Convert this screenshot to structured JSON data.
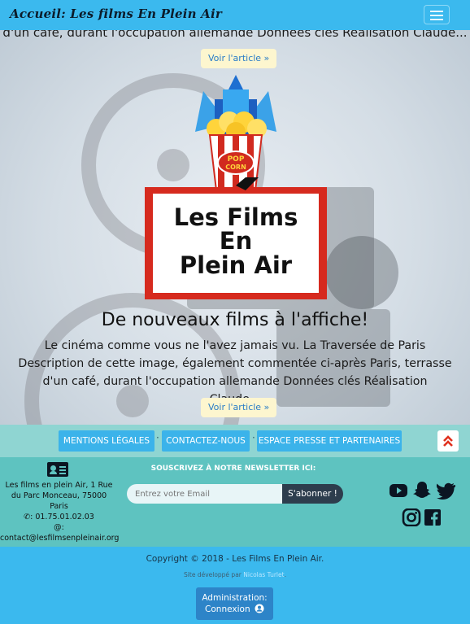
{
  "navbar": {
    "brand": "Accueil: Les films En Plein Air"
  },
  "articles": [
    {
      "excerpt_tail": "d'un café, durant l'occupation allemande Données clés Réalisation Claude...",
      "button": "Voir l'article »"
    },
    {
      "title": "De nouveaux films à l'affiche!",
      "line1": "Le cinéma comme vous ne l'avez jamais vu. La Traversée de Paris",
      "line2": "Description de cette image, également commentée ci-après Paris, terrasse",
      "line3": "d'un café, durant l'occupation allemande Données clés Réalisation Claude...",
      "button": "Voir l'article »"
    }
  ],
  "logo": {
    "line1": "Les Films",
    "line2": "En",
    "line3": "Plein Air",
    "popcorn1": "POP",
    "popcorn2": "CORN"
  },
  "footer_links": [
    "MENTIONS LÉGALES",
    "CONTACTEZ-NOUS",
    "ESPACE PRESSE ET PARTENAIRES"
  ],
  "separator": "·",
  "scroll_top_icon": "double-chevron-up-icon",
  "contact": {
    "address_1": "Les films en plein Air, 1 Rue",
    "address_2": "du Parc Monceau, 75000",
    "address_3": "Paris",
    "phone": ": 01.75.01.02.03",
    "email_label": "@:",
    "email": "contact@lesfilmsenpleinair.org"
  },
  "newsletter": {
    "title": "SOUSCRIVEZ À NOTRE NEWSLETTER ICI:",
    "placeholder": "Entrez votre Email",
    "button": "S'abonner !"
  },
  "social_icons": [
    "youtube-icon",
    "snapchat-icon",
    "twitter-icon",
    "instagram-icon",
    "facebook-icon"
  ],
  "copyright": "Copyright © 2018 - Les Films En Plein Air.",
  "developer": {
    "prefix": "Site développé par ",
    "name": "Nicolas Turlet",
    "suffix": "."
  },
  "admin": {
    "line1": "Administration:",
    "line2": "Connexion"
  },
  "colors": {
    "navbar": "#3bb9ee",
    "footer_teal": "#5ec3c0",
    "footer_light": "#8fd5d2",
    "button_blue": "#3bb3ea",
    "accent_red": "#e0301e"
  }
}
